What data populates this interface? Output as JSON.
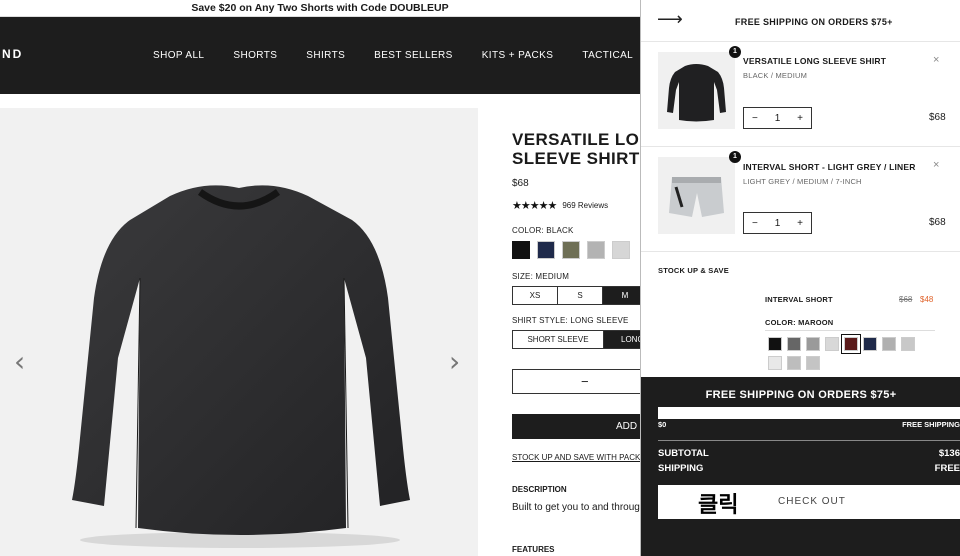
{
  "promo": "Save $20 on Any Two Shorts with Code DOUBLEUP",
  "header": {
    "logo": "ND",
    "nav": [
      "SHOP ALL",
      "SHORTS",
      "SHIRTS",
      "BEST SELLERS",
      "KITS + PACKS",
      "TACTICAL"
    ]
  },
  "gallery": {
    "prev": "‹",
    "next": "›"
  },
  "product": {
    "title": "VERSATILE LONG SLEEVE SHIRT",
    "price": "$68",
    "stars": "★★★★★",
    "reviews": "969 Reviews",
    "color_label": "COLOR: BLACK",
    "swatch_colors": [
      "#111111",
      "#1f2a4a",
      "#6e6f55",
      "#b3b3b3",
      "#d6d6d6"
    ],
    "size_label": "SIZE: MEDIUM",
    "sizes": [
      "XS",
      "S",
      "M"
    ],
    "style_label": "SHIRT STYLE: LONG SLEEVE",
    "styles": [
      "SHORT SLEEVE",
      "LONG SLEEVE"
    ],
    "qty_minus": "−",
    "add_label": "ADD TO CART",
    "stock_link": "STOCK UP AND SAVE WITH PACKS",
    "desc_title": "DESCRIPTION",
    "desc_text": "Built to get you to and through",
    "features_title": "FEATURES"
  },
  "cart": {
    "back": "⟶",
    "banner": "FREE SHIPPING ON ORDERS $75+",
    "items": [
      {
        "badge": "1",
        "name": "VERSATILE LONG SLEEVE SHIRT",
        "variant": "BLACK / MEDIUM",
        "remove": "×",
        "qty": "1",
        "minus": "−",
        "plus": "+",
        "price": "$68"
      },
      {
        "badge": "1",
        "name": "INTERVAL SHORT - LIGHT GREY / LINER",
        "variant": "LIGHT GREY / MEDIUM / 7-INCH",
        "remove": "×",
        "qty": "1",
        "minus": "−",
        "plus": "+",
        "price": "$68"
      }
    ],
    "stock_title": "STOCK UP & SAVE",
    "upsell": {
      "name": "INTERVAL SHORT",
      "old_price": "$68",
      "new_price": "$48",
      "color_label": "COLOR: MAROON",
      "swatches": [
        "#111111",
        "#666666",
        "#9a9a9a",
        "#d8d8d8",
        "#5a1a1a",
        "#1f2a4a",
        "#b0b0b0",
        "#c8c8c8",
        "#e8e8e8",
        "#bdbdbd",
        "#c4c4c4"
      ]
    },
    "checkout": {
      "banner": "FREE SHIPPING ON ORDERS $75+",
      "progress": 1.0,
      "prog_left": "$0",
      "prog_right": "FREE SHIPPING",
      "subtotal_label": "SUBTOTAL",
      "subtotal_value": "$136",
      "shipping_label": "SHIPPING",
      "shipping_value": "FREE",
      "overlay": "클릭",
      "button": "CHECK OUT"
    }
  }
}
